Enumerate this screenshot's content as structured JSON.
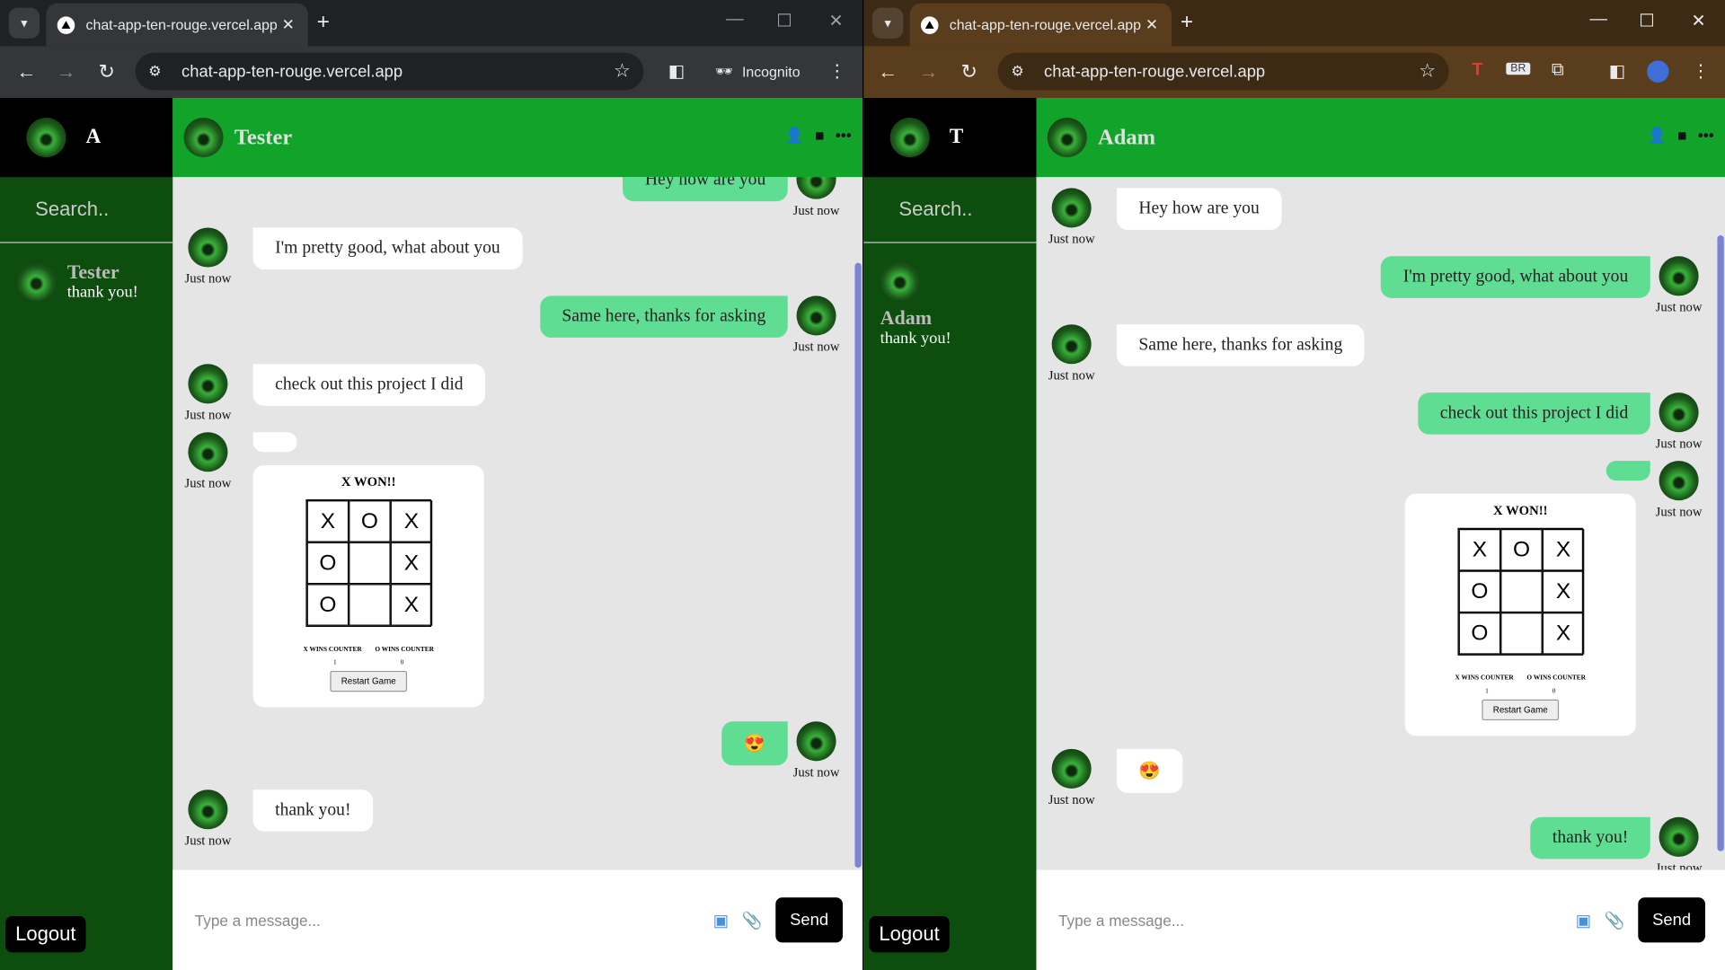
{
  "left_window": {
    "tab_title": "chat-app-ten-rouge.vercel.app",
    "url": "chat-app-ten-rouge.vercel.app",
    "incognito_label": "Incognito",
    "user_initial": "A",
    "search_placeholder": "Search..",
    "contact": {
      "name": "Tester",
      "last_message": "thank you!"
    },
    "chat_partner": "Tester",
    "logout_label": "Logout",
    "composer_placeholder": "Type a message...",
    "send_label": "Send",
    "messages": [
      {
        "text": "Hey how are you",
        "time": "Just now"
      },
      {
        "text": "I'm pretty good, what about you",
        "time": "Just now"
      },
      {
        "text": "Same here, thanks for asking",
        "time": "Just now"
      },
      {
        "text": "check out this project I did",
        "time": "Just now"
      },
      {
        "text": "",
        "time": "Just now"
      },
      {
        "text": "😍",
        "time": "Just now"
      },
      {
        "text": "thank you!",
        "time": "Just now"
      }
    ],
    "game": {
      "title": "X WON!!",
      "board": [
        "X",
        "O",
        "X",
        "O",
        "",
        "X",
        "O",
        "",
        "X"
      ],
      "x_counter_label": "X WINS COUNTER",
      "o_counter_label": "O WINS COUNTER",
      "x_wins": "1",
      "o_wins": "0",
      "restart_label": "Restart Game"
    }
  },
  "right_window": {
    "tab_title": "chat-app-ten-rouge.vercel.app",
    "url": "chat-app-ten-rouge.vercel.app",
    "user_initial": "T",
    "search_placeholder": "Search..",
    "contact": {
      "name": "Adam",
      "last_message": "thank you!"
    },
    "chat_partner": "Adam",
    "logout_label": "Logout",
    "composer_placeholder": "Type a message...",
    "send_label": "Send",
    "messages": [
      {
        "text": "Hey how are you",
        "time": "Just now"
      },
      {
        "text": "I'm pretty good, what about you",
        "time": "Just now"
      },
      {
        "text": "Same here, thanks for asking",
        "time": "Just now"
      },
      {
        "text": "check out this project I did",
        "time": "Just now"
      },
      {
        "text": "",
        "time": "Just now"
      },
      {
        "text": "😍",
        "time": "Just now"
      },
      {
        "text": "thank you!",
        "time": "Just now"
      }
    ],
    "game": {
      "title": "X WON!!",
      "board": [
        "X",
        "O",
        "X",
        "O",
        "",
        "X",
        "O",
        "",
        "X"
      ],
      "x_counter_label": "X WINS COUNTER",
      "o_counter_label": "O WINS COUNTER",
      "x_wins": "1",
      "o_wins": "0",
      "restart_label": "Restart Game"
    }
  },
  "colors": {
    "header_green": "#12a42a",
    "sidebar_green": "#0d4d0d",
    "bubble_green": "#5fdd92",
    "chat_bg": "#e5e5e5"
  },
  "icons": [
    "add-user-icon",
    "video-icon",
    "more-icon",
    "image-icon",
    "attach-icon",
    "star-icon",
    "reload-icon",
    "back-icon",
    "forward-icon"
  ]
}
